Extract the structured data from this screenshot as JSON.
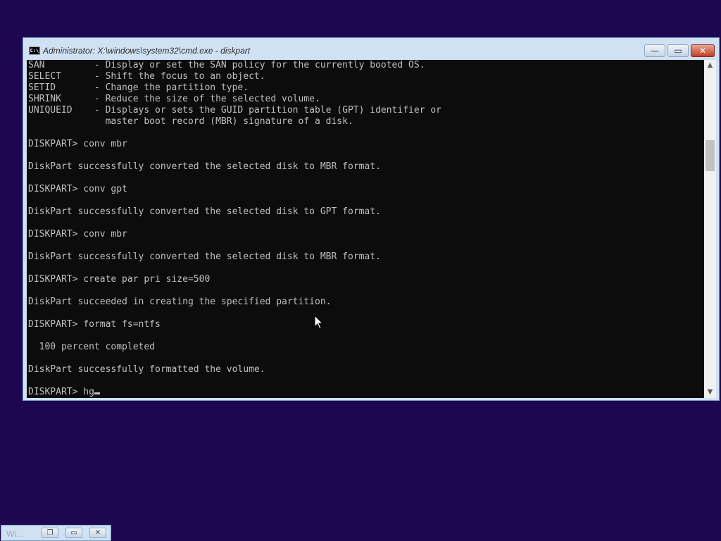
{
  "window": {
    "icon_text": "C:\\",
    "title": "Administrator: X:\\windows\\system32\\cmd.exe - diskpart",
    "controls": {
      "minimize": "—",
      "maximize": "▭",
      "close": "✕"
    }
  },
  "console": {
    "lines": [
      "SAN         - Display or set the SAN policy for the currently booted OS.",
      "SELECT      - Shift the focus to an object.",
      "SETID       - Change the partition type.",
      "SHRINK      - Reduce the size of the selected volume.",
      "UNIQUEID    - Displays or sets the GUID partition table (GPT) identifier or",
      "              master boot record (MBR) signature of a disk.",
      "",
      "DISKPART> conv mbr",
      "",
      "DiskPart successfully converted the selected disk to MBR format.",
      "",
      "DISKPART> conv gpt",
      "",
      "DiskPart successfully converted the selected disk to GPT format.",
      "",
      "DISKPART> conv mbr",
      "",
      "DiskPart successfully converted the selected disk to MBR format.",
      "",
      "DISKPART> create par pri size=500",
      "",
      "DiskPart succeeded in creating the specified partition.",
      "",
      "DISKPART> format fs=ntfs",
      "",
      "  100 percent completed",
      "",
      "DiskPart successfully formatted the volume.",
      ""
    ],
    "prompt": "DISKPART> ",
    "input": "hg"
  },
  "scrollbar": {
    "up_arrow": "▲",
    "down_arrow": "▼"
  },
  "taskbar": {
    "label": "Wi...",
    "buttons": {
      "restore": "❐",
      "maximize": "▭",
      "close": "✕"
    }
  }
}
